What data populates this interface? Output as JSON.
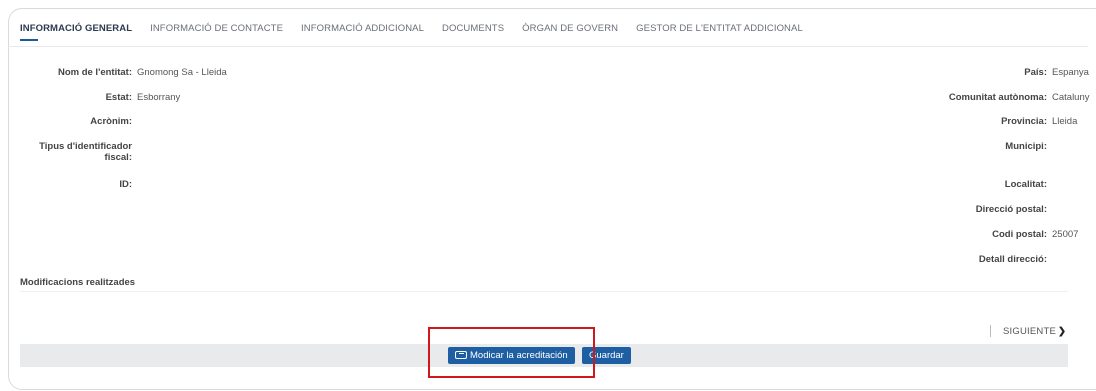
{
  "tabs": [
    {
      "label": "INFORMACIÓ GENERAL",
      "active": true
    },
    {
      "label": "INFORMACIÓ DE CONTACTE"
    },
    {
      "label": "INFORMACIÓ ADDICIONAL"
    },
    {
      "label": "DOCUMENTS"
    },
    {
      "label": "ÒRGAN DE GOVERN"
    },
    {
      "label": "GESTOR DE L'ENTITAT ADDICIONAL"
    }
  ],
  "left_fields": [
    {
      "label": "Nom de l'entitat:",
      "value": "Gnomong Sa - Lleida"
    },
    {
      "label": "Estat:",
      "value": "Esborrany"
    },
    {
      "label": "Acrònim:",
      "value": ""
    },
    {
      "label": "Tipus d'identificador",
      "label2": "fiscal:",
      "value": ""
    },
    {
      "label": "ID:",
      "value": ""
    }
  ],
  "right_fields": [
    {
      "label": "País:",
      "value": "Espanya"
    },
    {
      "label": "Comunitat autònoma:",
      "value": "Cataluny"
    },
    {
      "label": "Provincia:",
      "value": "Lleida"
    },
    {
      "label": "Municipi:",
      "value": ""
    },
    {
      "label": "Localitat:",
      "value": ""
    },
    {
      "label": "Direcció postal:",
      "value": ""
    },
    {
      "label": "Codi postal:",
      "value": "25007"
    },
    {
      "label": "Detall direcció:",
      "value": ""
    }
  ],
  "modifications_title": "Modificacions realitzades",
  "next_label": "SIGUIENTE",
  "buttons": {
    "accreditation": "Modicar la acreditación",
    "save": "Guardar"
  },
  "colors": {
    "primary": "#1e5fa3",
    "highlight": "#d0171b"
  }
}
